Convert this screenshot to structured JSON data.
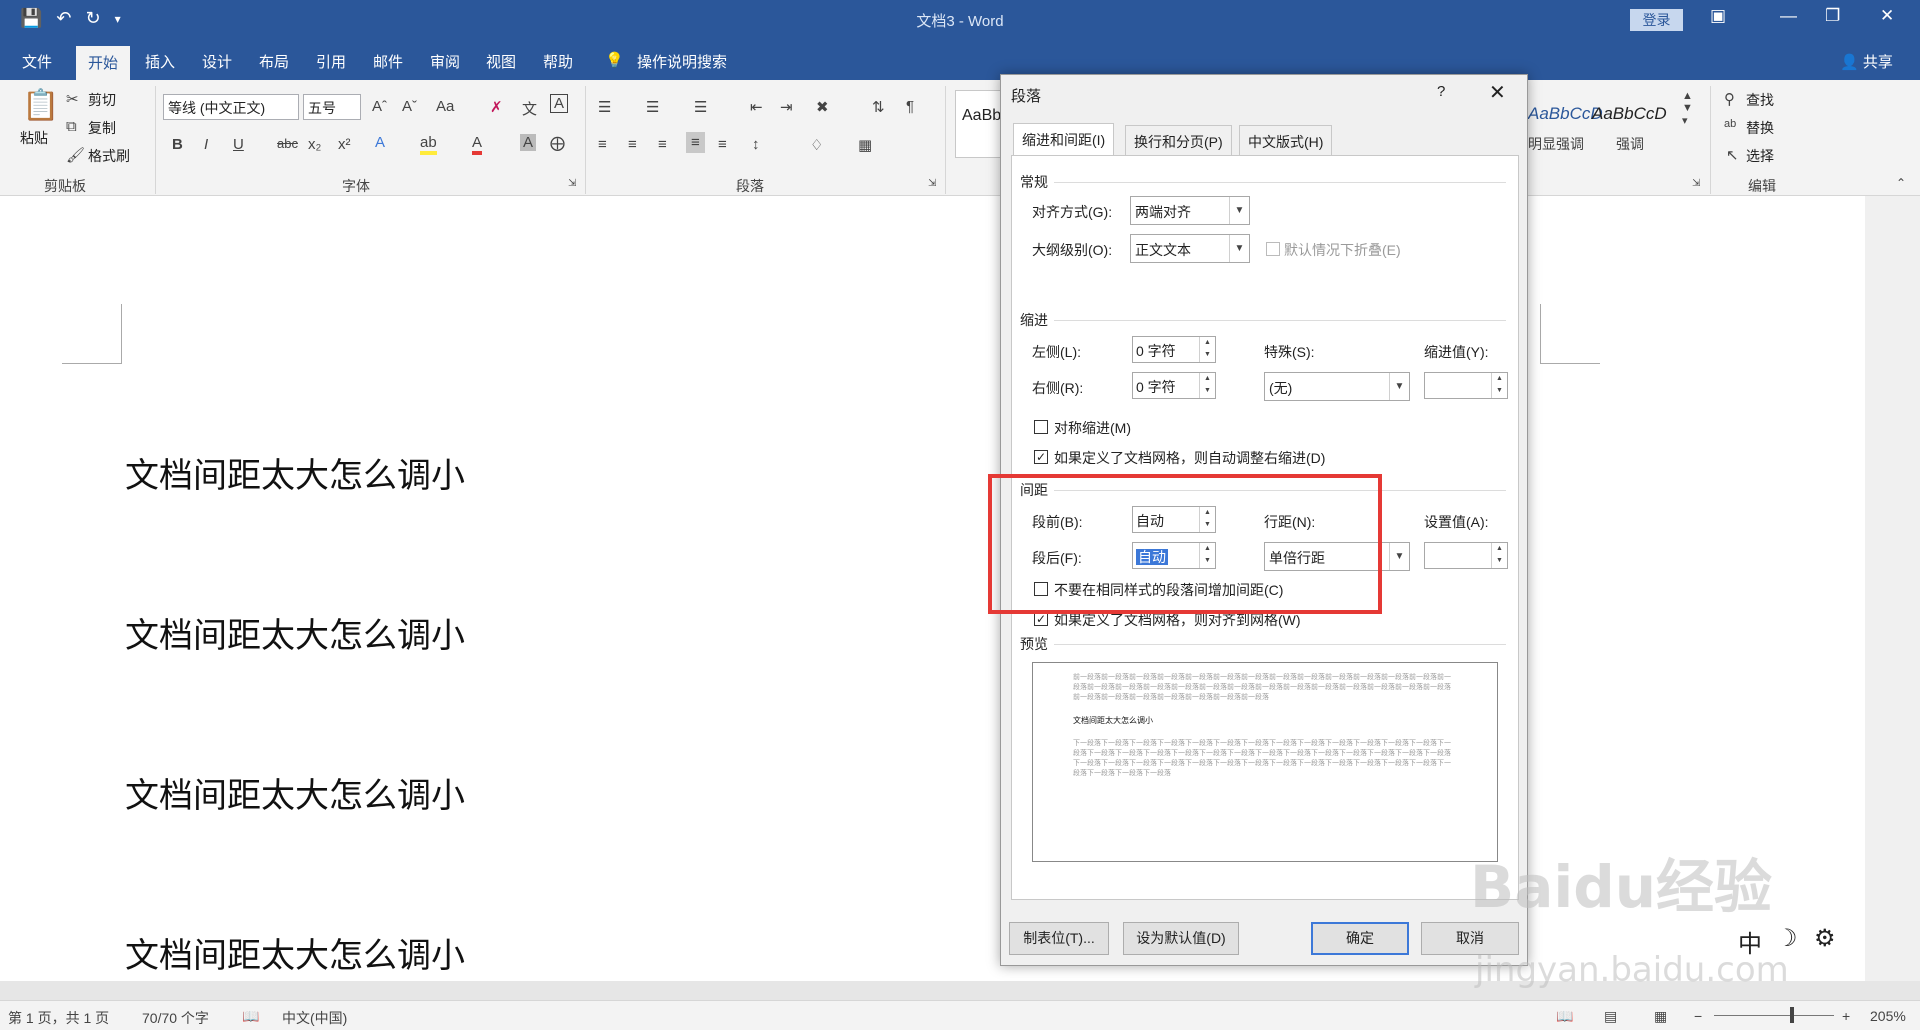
{
  "titlebar": {
    "title": "文档3 - Word",
    "login": "登录",
    "qat_icons": [
      "save-icon",
      "undo-icon",
      "redo-icon",
      "customize-icon"
    ]
  },
  "tabs": {
    "items": [
      "文件",
      "开始",
      "插入",
      "设计",
      "布局",
      "引用",
      "邮件",
      "审阅",
      "视图",
      "帮助"
    ],
    "active": "开始",
    "tell_me": "操作说明搜索",
    "share": "共享"
  },
  "ribbon": {
    "clipboard": {
      "paste": "粘贴",
      "cut": "剪切",
      "copy": "复制",
      "format_painter": "格式刷",
      "label": "剪贴板"
    },
    "font": {
      "font_name": "等线 (中文正文)",
      "font_size": "五号",
      "label": "字体"
    },
    "paragraph": {
      "label": "段落"
    },
    "styles": {
      "sample1": "AaBb",
      "sample2": "AaBbCcD",
      "sample3": "AaBbCcD",
      "style2_name": "明显强调",
      "style3_name": "强调"
    },
    "editing": {
      "find": "查找",
      "replace": "替换",
      "select": "选择",
      "label": "编辑"
    }
  },
  "document": {
    "lines": [
      "文档间距太大怎么调小",
      "文档间距太大怎么调小",
      "文档间距太大怎么调小",
      "文档间距太大怎么调小"
    ]
  },
  "statusbar": {
    "page": "第 1 页，共 1 页",
    "words": "70/70 个字",
    "language": "中文(中国)",
    "zoom": "205%"
  },
  "dialog": {
    "title": "段落",
    "help": "?",
    "tabs": [
      "缩进和间距(I)",
      "换行和分页(P)",
      "中文版式(H)"
    ],
    "general": {
      "section": "常规",
      "alignment_label": "对齐方式(G):",
      "alignment_value": "两端对齐",
      "outline_label": "大纲级别(O):",
      "outline_value": "正文文本",
      "collapse_label": "默认情况下折叠(E)"
    },
    "indent": {
      "section": "缩进",
      "left_label": "左侧(L):",
      "left_value": "0 字符",
      "right_label": "右侧(R):",
      "right_value": "0 字符",
      "special_label": "特殊(S):",
      "special_value": "(无)",
      "indent_by_label": "缩进值(Y):",
      "mirror_label": "对称缩进(M)",
      "auto_adjust_label": "如果定义了文档网格，则自动调整右缩进(D)"
    },
    "spacing": {
      "section": "间距",
      "before_label": "段前(B):",
      "before_value": "自动",
      "after_label": "段后(F):",
      "after_value": "自动",
      "line_label": "行距(N):",
      "line_value": "单倍行距",
      "at_label": "设置值(A):",
      "no_space_label": "不要在相同样式的段落间增加间距(C)",
      "snap_grid_label": "如果定义了文档网格，则对齐到网格(W)"
    },
    "preview": {
      "section": "预览",
      "prev_text": "前一段落前一段落前一段落前一段落前一段落前一段落前一段落前一段落前一段落前一段落前一段落前一段落前一段落前一段落前一段落前一段落前一段落前一段落前一段落前一段落前一段落前一段落前一段落前一段落前一段落前一段落前一段落前一段落前一段落前一段落前一段落前一段落前一段落前一段落",
      "main_text": "文档间距太大怎么调小",
      "next_text": "下一段落下一段落下一段落下一段落下一段落下一段落下一段落下一段落下一段落下一段落下一段落下一段落下一段落下一段落下一段落下一段落下一段落下一段落下一段落下一段落下一段落下一段落下一段落下一段落下一段落下一段落下一段落下一段落下一段落下一段落下一段落下一段落下一段落下一段落下一段落下一段落下一段落下一段落下一段落下一段落下一段落下一段落下一段落下一段落"
    },
    "buttons": {
      "tabs": "制表位(T)...",
      "default": "设为默认值(D)",
      "ok": "确定",
      "cancel": "取消"
    }
  },
  "overlay": {
    "watermark": "Baidu经验",
    "watermark_sub": "jingyan.baidu.com",
    "ime_mode": "中"
  },
  "colors": {
    "word_blue": "#2b579a",
    "highlight_red": "#e53935",
    "selection_blue": "#3c78d8"
  }
}
